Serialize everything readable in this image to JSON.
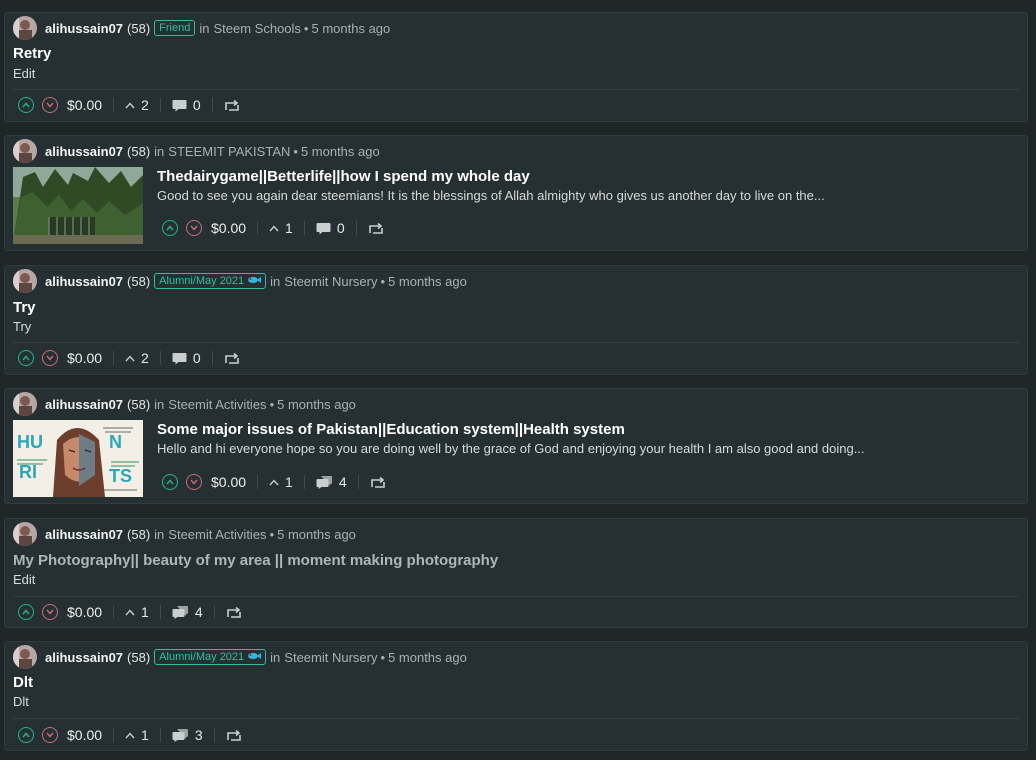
{
  "posts": [
    {
      "author": "alihussain07",
      "reputation": "(58)",
      "badge": "Friend",
      "in_label": "in",
      "community": "Steem Schools",
      "dot": "•",
      "time": "5 months ago",
      "title": "Retry",
      "body": "Edit",
      "payout": "$0.00",
      "votes": "2",
      "comments": "0",
      "comment_icon": "comment-icon",
      "thumbnail": null,
      "title_faded": false
    },
    {
      "author": "alihussain07",
      "reputation": "(58)",
      "badge": null,
      "in_label": "in",
      "community": "STEEMIT PAKISTAN",
      "dot": "•",
      "time": "5 months ago",
      "title": "Thedairygame||Betterlife||how I spend my whole day",
      "body": "Good to see you again dear steemians! It is the blessings of Allah almighty who gives us another day to live on the...",
      "payout": "$0.00",
      "votes": "1",
      "comments": "0",
      "comment_icon": "comment-icon",
      "thumbnail": "garden-gate-photo",
      "title_faded": false
    },
    {
      "author": "alihussain07",
      "reputation": "(58)",
      "badge": "Alumni/May 2021",
      "in_label": "in",
      "community": "Steemit Nursery",
      "dot": "•",
      "time": "5 months ago",
      "title": "Try",
      "body": "Try",
      "payout": "$0.00",
      "votes": "2",
      "comments": "0",
      "comment_icon": "comment-icon",
      "thumbnail": null,
      "title_faded": false
    },
    {
      "author": "alihussain07",
      "reputation": "(58)",
      "badge": null,
      "in_label": "in",
      "community": "Steemit Activities",
      "dot": "•",
      "time": "5 months ago",
      "title": "Some major issues of Pakistan||Education system||Health system",
      "body": "Hello and hi everyone hope so you are doing well by the grace of God and enjoying your health I am also good and doing...",
      "payout": "$0.00",
      "votes": "1",
      "comments": "4",
      "comment_icon": "comments-multiple-icon",
      "thumbnail": "human-rights-drawing",
      "thumbnail_text": [
        "HU",
        "N",
        "RI",
        "TS"
      ],
      "title_faded": false
    },
    {
      "author": "alihussain07",
      "reputation": "(58)",
      "badge": null,
      "in_label": "in",
      "community": "Steemit Activities",
      "dot": "•",
      "time": "5 months ago",
      "title": "My Photography|| beauty of my area || moment making photography",
      "body": "Edit",
      "payout": "$0.00",
      "votes": "1",
      "comments": "4",
      "comment_icon": "comments-multiple-icon",
      "thumbnail": null,
      "title_faded": true
    },
    {
      "author": "alihussain07",
      "reputation": "(58)",
      "badge": "Alumni/May 2021",
      "in_label": "in",
      "community": "Steemit Nursery",
      "dot": "•",
      "time": "5 months ago",
      "title": "Dlt",
      "body": "Dlt",
      "payout": "$0.00",
      "votes": "1",
      "comments": "3",
      "comment_icon": "comments-multiple-icon",
      "thumbnail": null,
      "title_faded": false
    }
  ],
  "colors": {
    "background": "#1e2628",
    "card": "#263033",
    "accent": "#2fbf9f",
    "upvote": "#20b591",
    "downvote": "#c76d78"
  }
}
